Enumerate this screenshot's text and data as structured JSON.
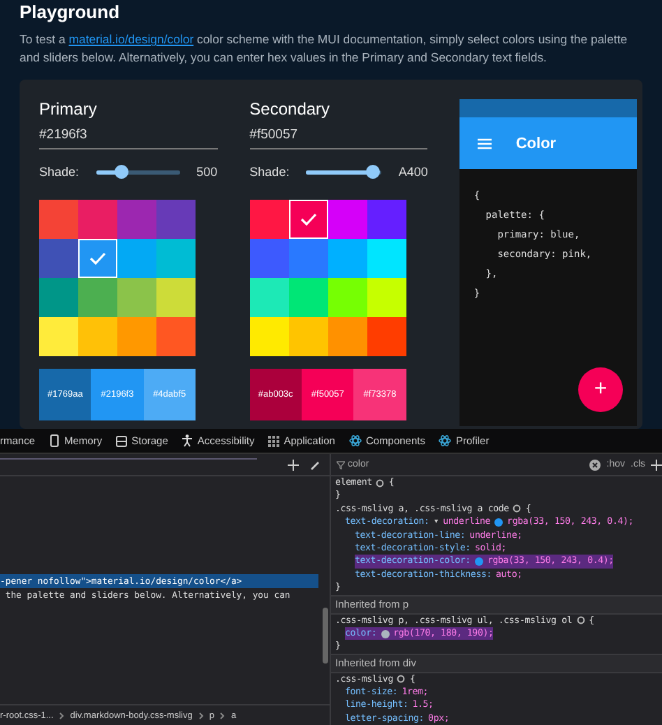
{
  "page": {
    "title": "Playground",
    "intro_before": "To test a ",
    "intro_link": "material.io/design/color",
    "intro_after": " color scheme with the MUI documentation, simply select colors using the palette and sliders below. Alternatively, you can enter hex values in the Primary and Secondary text fields."
  },
  "pickers": [
    {
      "title": "Primary",
      "value": "#2196f3",
      "shade_label": "Shade:",
      "level": 0.3,
      "shade": "500",
      "swatches": [
        {
          "color": "#f44336",
          "selected": false
        },
        {
          "color": "#e91e63",
          "selected": false
        },
        {
          "color": "#9c27b0",
          "selected": false
        },
        {
          "color": "#673ab7",
          "selected": false
        },
        {
          "color": "#3f51b5",
          "selected": false
        },
        {
          "color": "#2196f3",
          "selected": true
        },
        {
          "color": "#03a9f4",
          "selected": false
        },
        {
          "color": "#00bcd4",
          "selected": false
        },
        {
          "color": "#009688",
          "selected": false
        },
        {
          "color": "#4caf50",
          "selected": false
        },
        {
          "color": "#8bc34a",
          "selected": false
        },
        {
          "color": "#cddc39",
          "selected": false
        },
        {
          "color": "#ffeb3b",
          "selected": false
        },
        {
          "color": "#ffc107",
          "selected": false
        },
        {
          "color": "#ff9800",
          "selected": false
        },
        {
          "color": "#ff5722",
          "selected": false
        }
      ],
      "shades": [
        {
          "label": "#1769aa",
          "color": "#1769aa"
        },
        {
          "label": "#2196f3",
          "color": "#2196f3"
        },
        {
          "label": "#4dabf5",
          "color": "#4dabf5"
        }
      ]
    },
    {
      "title": "Secondary",
      "value": "#f50057",
      "shade_label": "Shade:",
      "level": 0.88,
      "shade": "A400",
      "swatches": [
        {
          "color": "#ff1744",
          "selected": false
        },
        {
          "color": "#f50057",
          "selected": true
        },
        {
          "color": "#d500f9",
          "selected": false
        },
        {
          "color": "#651fff",
          "selected": false
        },
        {
          "color": "#3d5afe",
          "selected": false
        },
        {
          "color": "#2979ff",
          "selected": false
        },
        {
          "color": "#00b0ff",
          "selected": false
        },
        {
          "color": "#00e5ff",
          "selected": false
        },
        {
          "color": "#1de9b6",
          "selected": false
        },
        {
          "color": "#00e676",
          "selected": false
        },
        {
          "color": "#76ff03",
          "selected": false
        },
        {
          "color": "#c6ff00",
          "selected": false
        },
        {
          "color": "#ffea00",
          "selected": false
        },
        {
          "color": "#ffc400",
          "selected": false
        },
        {
          "color": "#ff9100",
          "selected": false
        },
        {
          "color": "#ff3d00",
          "selected": false
        }
      ],
      "shades": [
        {
          "label": "#ab003c",
          "color": "#ab003c"
        },
        {
          "label": "#f50057",
          "color": "#f50057"
        },
        {
          "label": "#f73378",
          "color": "#f73378"
        }
      ]
    }
  ],
  "preview": {
    "title": "Color",
    "code": "{\n  palette: {\n    primary: blue,\n    secondary: pink,\n  },\n}",
    "fab": "+"
  },
  "devtools": {
    "tabs": [
      "rmance",
      "Memory",
      "Storage",
      "Accessibility",
      "Application",
      "Components",
      "Profiler"
    ],
    "filter": "color",
    "hov": ":hov",
    "cls": ".cls",
    "elements": [
      {
        "text": "-pener nofollow\">material.io/design/color</a>",
        "selected": true
      },
      {
        "text": " the palette and sliders below. Alternatively, you can",
        "selected": false
      }
    ],
    "breadcrumb": [
      "r-root.css-1...",
      "div.markdown-body.css-mslivg",
      "p",
      "a"
    ],
    "styles": [
      {
        "kind": "selector",
        "text": "element",
        "open": "{"
      },
      {
        "kind": "close",
        "text": "}"
      },
      {
        "kind": "selector",
        "text": ".css-mslivg a, .css-mslivg a code",
        "open": "{"
      },
      {
        "kind": "prop",
        "name": "text-decoration:",
        "value": "underline",
        "expander": "▾",
        "color": "#2196f3",
        "after": "rgba(33, 150, 243, 0.4);",
        "highlighted": false,
        "children": [
          {
            "kind": "prop",
            "name": "text-decoration-line:",
            "value": "underline;",
            "highlighted": false
          },
          {
            "kind": "prop",
            "name": "text-decoration-style:",
            "value": "solid;",
            "highlighted": false
          },
          {
            "kind": "prop",
            "name": "text-decoration-color:",
            "value": "rgba(33, 150, 243, 0.4);",
            "color": "#2196f3",
            "highlighted": true
          },
          {
            "kind": "prop",
            "name": "text-decoration-thickness:",
            "value": "auto;",
            "highlighted": false
          }
        ]
      },
      {
        "kind": "close",
        "text": "}"
      },
      {
        "kind": "header",
        "text": "Inherited from p"
      },
      {
        "kind": "selector",
        "text": ".css-mslivg p, .css-mslivg ul, .css-mslivg ol",
        "open": "{"
      },
      {
        "kind": "prop",
        "name": "color:",
        "value": "rgb(170, 180, 190);",
        "color": "#aab4be",
        "highlighted": true
      },
      {
        "kind": "close",
        "text": "}"
      },
      {
        "kind": "header",
        "text": "Inherited from div"
      },
      {
        "kind": "selector",
        "text": ".css-mslivg",
        "open": "{"
      },
      {
        "kind": "prop",
        "name": "font-size:",
        "value": "1rem;",
        "highlighted": false
      },
      {
        "kind": "prop",
        "name": "line-height:",
        "value": "1.5;",
        "highlighted": false
      },
      {
        "kind": "prop",
        "name": "letter-spacing:",
        "value": "0px;",
        "highlighted": false
      }
    ]
  }
}
